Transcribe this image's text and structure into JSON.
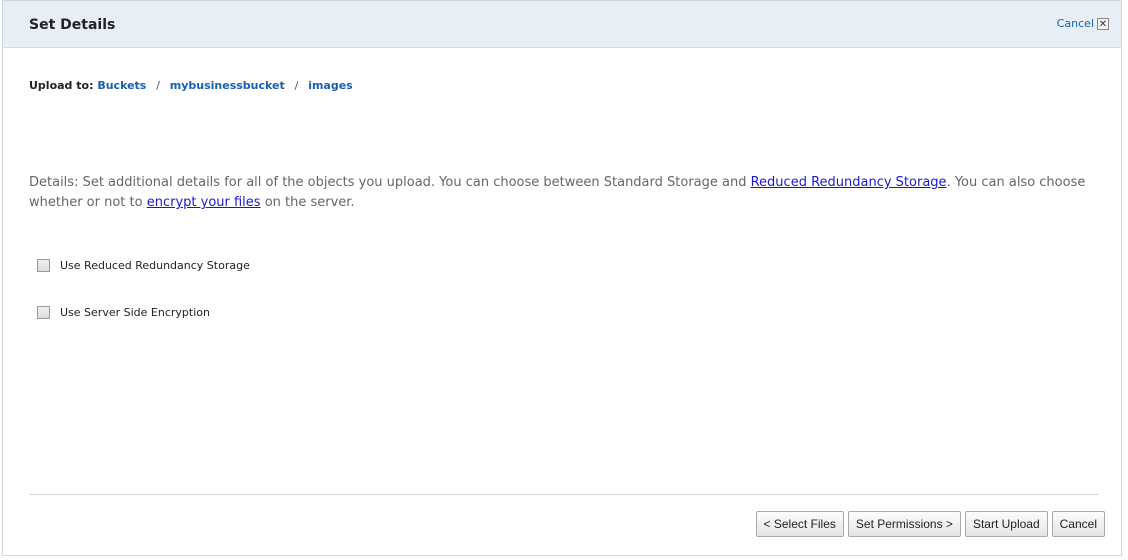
{
  "header": {
    "title": "Set Details",
    "cancel_label": "Cancel",
    "close_glyph": "✕"
  },
  "breadcrumb": {
    "prefix": "Upload to:",
    "items": [
      "Buckets",
      "mybusinessbucket",
      "images"
    ],
    "separator": "/"
  },
  "details": {
    "text_1": "Details: Set additional details for all of the objects you upload. You can choose between Standard Storage and ",
    "link_1": "Reduced Redundancy Storage",
    "text_2": ". You can also choose whether or not to ",
    "link_2": "encrypt your files",
    "text_3": " on the server."
  },
  "options": [
    {
      "label": "Use Reduced Redundancy Storage",
      "checked": false
    },
    {
      "label": "Use Server Side Encryption",
      "checked": false
    }
  ],
  "footer": {
    "select_files_label": "< Select Files",
    "set_permissions_label": "Set Permissions >",
    "start_upload_label": "Start Upload",
    "cancel_label": "Cancel"
  },
  "colors": {
    "header_bg": "#e8eef6",
    "link": "#1a5fb0",
    "inline_link": "#1a1acc"
  }
}
